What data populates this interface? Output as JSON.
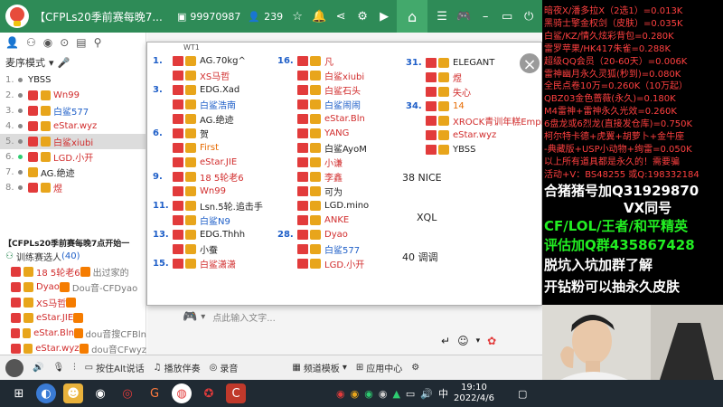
{
  "titlebar": {
    "title": "【CFPLs20季前赛每晚7...",
    "room_id": "99970987",
    "viewers": "239"
  },
  "left_panel": {
    "mode_label": "麦序模式",
    "tab_labels": [
      "放麦",
      "禁麦"
    ],
    "members": [
      {
        "num": "1.",
        "name": "YBSS",
        "dot": "gray",
        "badges": [],
        "color": "black"
      },
      {
        "num": "2.",
        "name": "Wn99",
        "dot": "gray",
        "badges": [
          "red",
          "gold"
        ],
        "color": "red"
      },
      {
        "num": "3.",
        "name": "白鲨577",
        "dot": "gray",
        "badges": [
          "red",
          "gold"
        ],
        "color": "blue"
      },
      {
        "num": "4.",
        "name": "eStar.wyz",
        "dot": "gray",
        "badges": [
          "red",
          "gold"
        ],
        "color": "red"
      },
      {
        "num": "5.",
        "name": "白鲨xiubi",
        "dot": "gray",
        "badges": [
          "red",
          "gold"
        ],
        "color": "red",
        "selected": true
      },
      {
        "num": "6.",
        "name": "LGD.小开",
        "dot": "green",
        "badges": [
          "red",
          "gold"
        ],
        "color": "red"
      },
      {
        "num": "7.",
        "name": "AG.绝迹",
        "dot": "gray",
        "badges": [
          "gold"
        ],
        "color": "black"
      },
      {
        "num": "8.",
        "name": "煜",
        "dot": "gray",
        "badges": [
          "red",
          "gold"
        ],
        "color": "red"
      }
    ],
    "channel_title": "【CFPLs20季前赛每晚7点开始一",
    "training_label": "训练赛选人",
    "training_count": "(40)",
    "channel_users": [
      {
        "name": "18 5轮老6",
        "tail": "出过家的",
        "color": "red"
      },
      {
        "name": "Dyao",
        "tail": "Dou音-CFDyao",
        "color": "red"
      },
      {
        "name": "XS马哲",
        "tail": "",
        "color": "red"
      },
      {
        "name": "eStar.JIE",
        "tail": "",
        "color": "red"
      },
      {
        "name": "eStar.Bln",
        "tail": "dou音搜CFBln",
        "color": "red"
      },
      {
        "name": "eStar.wyz",
        "tail": "dou音CFwyz",
        "color": "red"
      }
    ]
  },
  "popup": {
    "top_text": "WT1",
    "col1": [
      {
        "num": "1.",
        "name": "AG.70kg^",
        "color": "black"
      },
      {
        "num": "",
        "name": "XS马哲",
        "color": "red"
      },
      {
        "num": "3.",
        "name": "EDG.Xad",
        "color": "black"
      },
      {
        "num": "",
        "name": "白鲨浩南",
        "color": "blue"
      },
      {
        "num": "",
        "name": "AG.绝迹",
        "color": "black"
      },
      {
        "num": "6.",
        "name": "贺",
        "color": "black"
      },
      {
        "num": "",
        "name": "First",
        "color": "orange"
      },
      {
        "num": "",
        "name": "eStar.JIE",
        "color": "red"
      },
      {
        "num": "9.",
        "name": "18 5轮老6",
        "color": "red"
      },
      {
        "num": "",
        "name": "Wn99",
        "color": "red"
      },
      {
        "num": "11.",
        "name": "Lsn.5轮.追击手",
        "color": "black"
      },
      {
        "num": "",
        "name": "白鲨N9",
        "color": "blue"
      },
      {
        "num": "13.",
        "name": "EDG.Thhh",
        "color": "black"
      },
      {
        "num": "",
        "name": "小蚕",
        "color": "black"
      },
      {
        "num": "15.",
        "name": "白鲨潇潇",
        "color": "red"
      }
    ],
    "col2": [
      {
        "num": "16.",
        "name": "凡",
        "color": "red"
      },
      {
        "num": "",
        "name": "白鲨xiubi",
        "color": "red"
      },
      {
        "num": "",
        "name": "白鲨石头",
        "color": "red"
      },
      {
        "num": "",
        "name": "白鲨闹闹",
        "color": "blue"
      },
      {
        "num": "",
        "name": "eStar.Bln",
        "color": "red"
      },
      {
        "num": "",
        "name": "YANG",
        "color": "red"
      },
      {
        "num": "",
        "name": "白鲨AyoM",
        "color": "black"
      },
      {
        "num": "",
        "name": "小谦",
        "color": "red"
      },
      {
        "num": "",
        "name": "李鑫",
        "color": "red"
      },
      {
        "num": "",
        "name": "可为",
        "color": "black"
      },
      {
        "num": "",
        "name": "LGD.mino",
        "color": "black"
      },
      {
        "num": "",
        "name": "ANKE",
        "color": "red"
      },
      {
        "num": "28.",
        "name": "Dyao",
        "color": "red"
      },
      {
        "num": "",
        "name": "白鲨577",
        "color": "blue"
      },
      {
        "num": "",
        "name": "LGD.小开",
        "color": "red"
      }
    ],
    "col3": [
      {
        "num": "31.",
        "name": "ELEGANT",
        "color": "black"
      },
      {
        "num": "",
        "name": "煜",
        "color": "red"
      },
      {
        "num": "",
        "name": "失心",
        "color": "red"
      },
      {
        "num": "34.",
        "name": "14",
        "color": "orange"
      },
      {
        "num": "",
        "name": "XROCK青训年糕Empi",
        "color": "red"
      },
      {
        "num": "",
        "name": "eStar.wyz",
        "color": "red"
      },
      {
        "num": "",
        "name": "YBSS",
        "color": "black"
      }
    ]
  },
  "chat_messages": [
    "38 NICE",
    "XQL",
    "40 调调"
  ],
  "input": {
    "placeholder": "点此输入文字..."
  },
  "toolbar": {
    "items": [
      "按住Alt说话",
      "播放伴奏",
      "录音",
      "频道模板",
      "应用中心"
    ]
  },
  "overlay": {
    "price_lines": [
      "暗夜X/潘多拉X（2选1）=0.013K",
      "黑骑士擎金权剑（皮肤）=0.035K",
      "白鲨/KZ/情久炫彩背包=0.280K",
      "雷罗苹果/HK417朱雀=0.288K",
      "超级QQ会员（20-60天）=0.006K",
      "雷神幽月永久灵狐(秒到)=0.080K",
      "全民点卷10万=0.260K（10万起）",
      "QBZ03金色蔷薇(永久)=0.180K",
      "M4雷神+雷神永久光效=0.260K",
      "6盘龙或6烈龙(直接发仓库)=0.750K",
      "柯尔特卡德+虎翼+胡萝卜+金牛座",
      "-典藏版+USP小动物+绚雷=0.050K",
      "以上所有道具都是永久的！需要骗",
      "活动+V：BS48255   或Q:198332184"
    ],
    "big_lines": [
      {
        "text": "合猪猪号加Q31929870",
        "color": "#ffffff"
      },
      {
        "text": "VX同号",
        "color": "#ffffff"
      },
      {
        "text": "CF/LOL/王者/和平精英",
        "color": "#22ee22"
      },
      {
        "text": "评估加Q群435867428",
        "color": "#22ee22"
      },
      {
        "text": "脱坑入坑加群了解",
        "color": "#ffffff"
      },
      {
        "text": "开钻粉可以抽永久皮肤",
        "color": "#ffffff"
      }
    ]
  },
  "taskbar": {
    "time": "19:10",
    "date": "2022/4/6",
    "lang": "中"
  }
}
